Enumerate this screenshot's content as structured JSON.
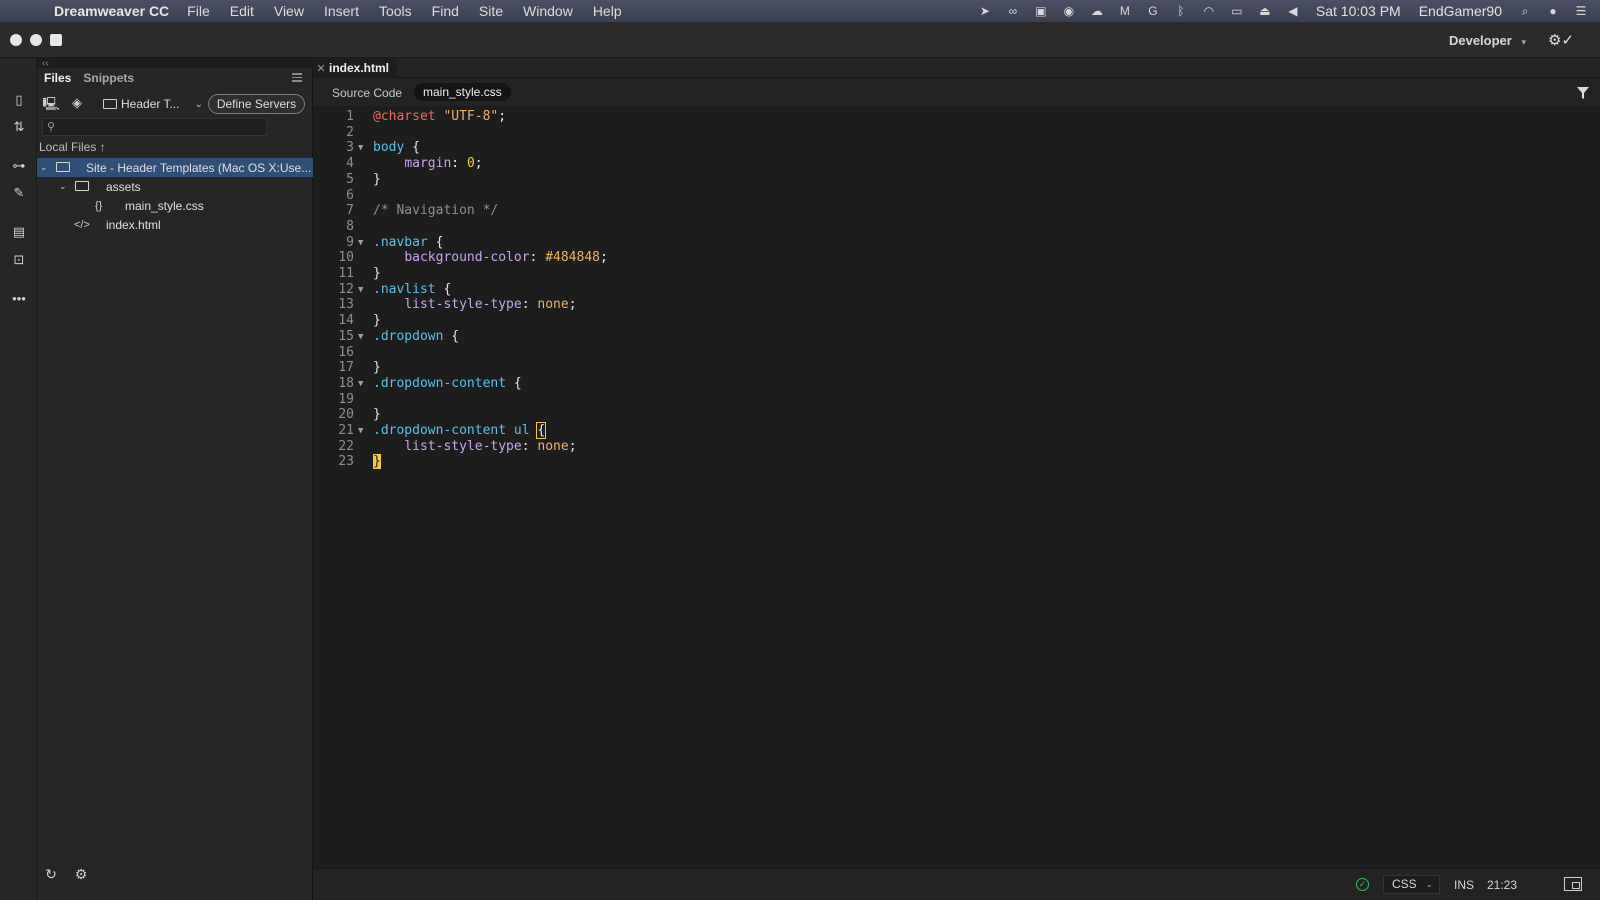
{
  "menubar": {
    "app_name": "Dreamweaver CC",
    "items": [
      "File",
      "Edit",
      "View",
      "Insert",
      "Tools",
      "Find",
      "Site",
      "Window",
      "Help"
    ],
    "clock": "Sat 10:03 PM",
    "user": "EndGamer90"
  },
  "titlebar": {
    "workspace": "Developer",
    "workspace_chevron": "▾"
  },
  "files_panel": {
    "tabs": [
      "Files",
      "Snippets"
    ],
    "site_select": "Header T...",
    "define_servers": "Define Servers",
    "search_placeholder": "",
    "local_files_label": "Local Files ↑",
    "tree": {
      "site": "Site - Header Templates (Mac OS X:Use...",
      "assets": "assets",
      "css_file": "main_style.css",
      "html_file": "index.html"
    }
  },
  "document": {
    "tab_name": "index.html",
    "source_code_label": "Source Code",
    "related_file": "main_style.css",
    "lines": [
      {
        "n": "1",
        "fold": "",
        "tokens": [
          [
            "t-at",
            "@charset"
          ],
          [
            "t-p",
            " "
          ],
          [
            "t-str",
            "\"UTF-8\""
          ],
          [
            "t-p",
            ";"
          ]
        ]
      },
      {
        "n": "2",
        "fold": "",
        "tokens": []
      },
      {
        "n": "3",
        "fold": "▼",
        "tokens": [
          [
            "t-sel",
            "body"
          ],
          [
            "t-p",
            " {"
          ]
        ]
      },
      {
        "n": "4",
        "fold": "",
        "tokens": [
          [
            "t-p",
            "    "
          ],
          [
            "t-prop",
            "margin"
          ],
          [
            "t-p",
            ": "
          ],
          [
            "t-num",
            "0"
          ],
          [
            "t-p",
            ";"
          ]
        ]
      },
      {
        "n": "5",
        "fold": "",
        "tokens": [
          [
            "t-p",
            "}"
          ]
        ]
      },
      {
        "n": "6",
        "fold": "",
        "tokens": []
      },
      {
        "n": "7",
        "fold": "",
        "tokens": [
          [
            "t-com",
            "/* Navigation */"
          ]
        ]
      },
      {
        "n": "8",
        "fold": "",
        "tokens": []
      },
      {
        "n": "9",
        "fold": "▼",
        "tokens": [
          [
            "t-sel",
            ".navbar"
          ],
          [
            "t-p",
            " {"
          ]
        ]
      },
      {
        "n": "10",
        "fold": "",
        "tokens": [
          [
            "t-p",
            "    "
          ],
          [
            "t-prop",
            "background-color"
          ],
          [
            "t-p",
            ": "
          ],
          [
            "t-val",
            "#484848"
          ],
          [
            "t-p",
            ";"
          ]
        ]
      },
      {
        "n": "11",
        "fold": "",
        "tokens": [
          [
            "t-p",
            "}"
          ]
        ]
      },
      {
        "n": "12",
        "fold": "▼",
        "tokens": [
          [
            "t-sel",
            ".navlist"
          ],
          [
            "t-p",
            " {"
          ]
        ]
      },
      {
        "n": "13",
        "fold": "",
        "tokens": [
          [
            "t-p",
            "    "
          ],
          [
            "t-prop",
            "list-style-type"
          ],
          [
            "t-p",
            ": "
          ],
          [
            "t-val",
            "none"
          ],
          [
            "t-p",
            ";"
          ]
        ]
      },
      {
        "n": "14",
        "fold": "",
        "tokens": [
          [
            "t-p",
            "}"
          ]
        ]
      },
      {
        "n": "15",
        "fold": "▼",
        "tokens": [
          [
            "t-sel",
            ".dropdown"
          ],
          [
            "t-p",
            " {"
          ]
        ]
      },
      {
        "n": "16",
        "fold": "",
        "tokens": []
      },
      {
        "n": "17",
        "fold": "",
        "tokens": [
          [
            "t-p",
            "}"
          ]
        ]
      },
      {
        "n": "18",
        "fold": "▼",
        "tokens": [
          [
            "t-sel",
            ".dropdown-content"
          ],
          [
            "t-p",
            " {"
          ]
        ]
      },
      {
        "n": "19",
        "fold": "",
        "tokens": []
      },
      {
        "n": "20",
        "fold": "",
        "tokens": [
          [
            "t-p",
            "}"
          ]
        ]
      },
      {
        "n": "21",
        "fold": "▼",
        "tokens": [
          [
            "t-sel",
            ".dropdown-content ul"
          ],
          [
            "t-p",
            " "
          ],
          [
            "t-brk",
            "{"
          ]
        ]
      },
      {
        "n": "22",
        "fold": "",
        "tokens": [
          [
            "t-p",
            "    "
          ],
          [
            "t-prop",
            "list-style-type"
          ],
          [
            "t-p",
            ": "
          ],
          [
            "t-val",
            "none"
          ],
          [
            "t-p",
            ";"
          ]
        ]
      },
      {
        "n": "23",
        "fold": "",
        "tokens": [
          [
            "t-brk2",
            "}"
          ]
        ]
      }
    ]
  },
  "statusbar": {
    "language": "CSS",
    "mode": "INS",
    "cursor_position": "21:23"
  },
  "colors": {
    "selected_row": "#2f4f78",
    "status_ok": "#3dbb5a",
    "bracket_highlight": "#f2c94c"
  },
  "icons": {
    "menubar_tray": [
      "send-icon",
      "creative-cloud-icon",
      "screen-capture-icon",
      "sync-icon",
      "cloud-upload-icon",
      "mail-icon",
      "google-icon",
      "bluetooth-icon",
      "wifi-icon",
      "airplay-icon",
      "eject-icon",
      "volume-icon"
    ],
    "left_toolbar": [
      "new-document-icon",
      "transfer-icon",
      "insert-icon",
      "css-designer-icon",
      "comments-icon",
      "assets-icon",
      "more-icon"
    ]
  }
}
